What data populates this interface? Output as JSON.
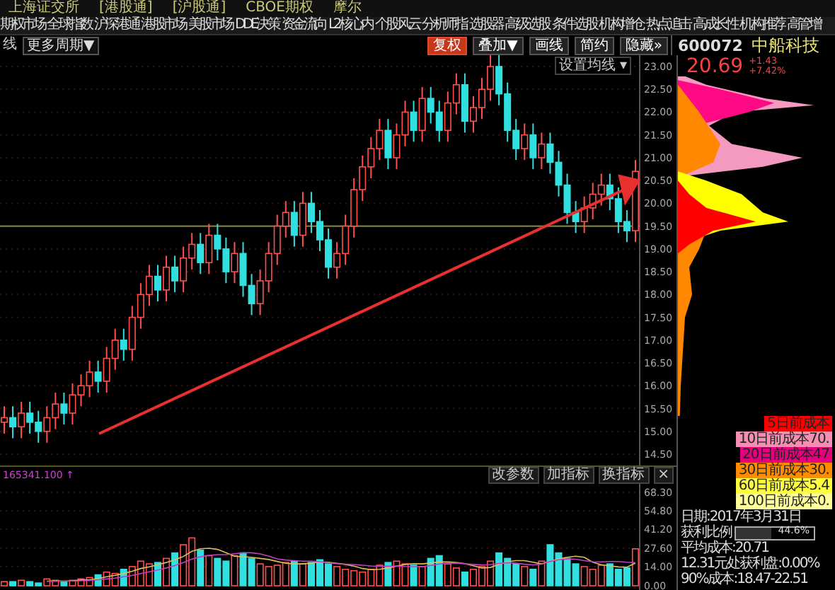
{
  "top_bar": {
    "items": [
      "上海证交所",
      "[港股通]",
      "[沪股通]",
      "CBOE期权",
      "摩尔"
    ]
  },
  "menu": {
    "items": [
      "期权市场",
      "全球指数",
      "沪深港通",
      "港股市场",
      "美股市场",
      "DDE决策",
      "资金流向",
      "L2核心内",
      "个股风云",
      "分析师指",
      "选股器",
      "高级选股",
      "条件选股",
      "机构增仓",
      "热点追击",
      "高成长性",
      "机构推荐",
      "高管增"
    ]
  },
  "toolbar": {
    "period_label": "线",
    "period_dropdown": "更多周期▼",
    "buttons": [
      {
        "label": "复权",
        "selected": true
      },
      {
        "label": "叠加▼",
        "selected": false
      },
      {
        "label": "画线",
        "selected": false
      },
      {
        "label": "简约",
        "selected": false
      },
      {
        "label": "隐藏»",
        "selected": false
      }
    ]
  },
  "stock": {
    "code": "600072",
    "name": "中船科技",
    "price": "20.69",
    "change": "+1.43",
    "change_pct": "+7.42%"
  },
  "price_chart": {
    "ma_setting": "设置均线 ▾",
    "axis_labels": [
      "23.00",
      "22.50",
      "22.00",
      "21.50",
      "21.00",
      "20.50",
      "20.00",
      "19.50",
      "19.00",
      "18.50",
      "18.00",
      "17.50",
      "17.00",
      "16.50",
      "16.00",
      "15.50",
      "15.00",
      "14.50"
    ]
  },
  "volume": {
    "reading": "165341.100",
    "arrow": "↑",
    "buttons": [
      "改参数",
      "加指标",
      "换指标",
      "×"
    ],
    "chart_data": {
      "type": "bar",
      "grid": true,
      "ylim": [
        0,
        68.3
      ],
      "yticks": [
        {
          "value": 68.3,
          "label": "68.30"
        },
        {
          "value": 54.8,
          "label": "54.80"
        },
        {
          "value": 41.2,
          "label": "41.20"
        },
        {
          "value": 27.6,
          "label": "27.60"
        },
        {
          "value": 14,
          "label": "14.00"
        },
        {
          "value": 0,
          "label": "0.00"
        }
      ],
      "series": [
        {
          "type": "bar",
          "color": "#ff5050",
          "values": [
            3,
            null,
            4,
            null,
            null,
            5,
            4,
            null,
            4,
            5,
            6,
            null,
            10,
            9,
            null,
            14,
            18,
            16,
            null,
            20,
            null,
            30,
            35,
            null,
            22,
            null,
            null,
            22,
            null,
            null,
            16,
            14,
            15,
            17,
            null,
            16,
            null,
            null,
            null,
            14,
            12,
            11,
            10,
            12,
            15,
            null,
            18,
            16,
            null,
            14,
            null,
            null,
            16,
            13,
            null,
            12,
            14,
            18,
            null,
            null,
            null,
            14,
            null,
            18,
            null,
            null,
            null,
            null,
            14,
            12,
            15,
            null,
            null,
            null,
            27
          ]
        },
        {
          "type": "bar",
          "color": "#30e0e0",
          "values": [
            null,
            3,
            null,
            3,
            2,
            null,
            null,
            3,
            null,
            null,
            null,
            8,
            null,
            null,
            12,
            null,
            null,
            null,
            17,
            null,
            24,
            null,
            null,
            26,
            null,
            20,
            18,
            null,
            24,
            20,
            null,
            null,
            null,
            null,
            18,
            null,
            17,
            19,
            16,
            null,
            null,
            null,
            null,
            null,
            null,
            17,
            null,
            null,
            15,
            null,
            20,
            22,
            null,
            null,
            10,
            null,
            null,
            null,
            24,
            20,
            16,
            null,
            12,
            null,
            30,
            24,
            20,
            16,
            null,
            null,
            null,
            16,
            12,
            13,
            null
          ]
        },
        {
          "type": "line",
          "color": "#d8c060",
          "values": [
            null,
            null,
            null,
            null,
            null,
            3.4,
            3.6,
            3.4,
            3.6,
            4.2,
            4.4,
            5.2,
            6.6,
            7.6,
            9,
            10.6,
            12.6,
            13.8,
            15.4,
            17,
            19,
            21.4,
            25.2,
            27,
            27.4,
            26.6,
            24.2,
            21.6,
            21.2,
            20.8,
            20,
            19.2,
            17.8,
            16.4,
            16,
            16,
            16.6,
            17.4,
            17.2,
            16.4,
            15.6,
            14.4,
            12.6,
            11.8,
            12,
            13,
            14.4,
            15.6,
            16.2,
            16,
            16.6,
            17.4,
            17.4,
            17,
            16.2,
            14.6,
            13,
            13.4,
            15.6,
            17.6,
            18.4,
            18.4,
            17.2,
            16,
            18,
            19.6,
            20.8,
            21.6,
            20.8,
            17.2,
            15.4,
            14.6,
            13.8,
            13.6,
            16.6
          ]
        },
        {
          "type": "line",
          "color": "#c040c0",
          "values": [
            null,
            null,
            null,
            null,
            null,
            3.2,
            3.3,
            3.4,
            3.5,
            3.6,
            3.9,
            4.4,
            5,
            5.6,
            6.6,
            7.5,
            8.9,
            10.2,
            11.5,
            13,
            14.8,
            17,
            19.5,
            21.2,
            22.2,
            22.8,
            22.8,
            23.4,
            24.1,
            24.1,
            23.3,
            21.7,
            19.7,
            18.8,
            18.4,
            18,
            17.9,
            17.6,
            16.8,
            16.2,
            15.8,
            15.5,
            15,
            14.5,
            14.2,
            14.3,
            14.4,
            14.1,
            14,
            14,
            14.8,
            15.9,
            16.5,
            16.6,
            16.1,
            15.6,
            15.2,
            15.4,
            16.3,
            16.9,
            16.5,
            15.7,
            15.3,
            15.8,
            17.8,
            19,
            19.6,
            19.4,
            18.4,
            17.6,
            17.5,
            17.7,
            17.7,
            17.2,
            16.9
          ]
        }
      ]
    }
  },
  "chip_panel": {
    "legend": [
      {
        "label": "5日前成本",
        "color": "#ff0000"
      },
      {
        "label": "10日前成本70.",
        "color": "#f48fb1"
      },
      {
        "label": "20日前成本47",
        "color": "#e6007e"
      },
      {
        "label": "30日前成本30.",
        "color": "#ff8c00"
      },
      {
        "label": "60日前成本5.4",
        "color": "#ffff40"
      },
      {
        "label": "100日前成本0.",
        "color": "#ffff99"
      }
    ],
    "date": "日期:2017年3月31日",
    "profit_ratio": {
      "label": "获利比例",
      "level": 0.446,
      "reading": "44.6%"
    },
    "info": [
      "平均成本:20.71",
      "12.31元处获利盘:0.00%",
      "90%成本:18.47-22.51"
    ]
  }
}
